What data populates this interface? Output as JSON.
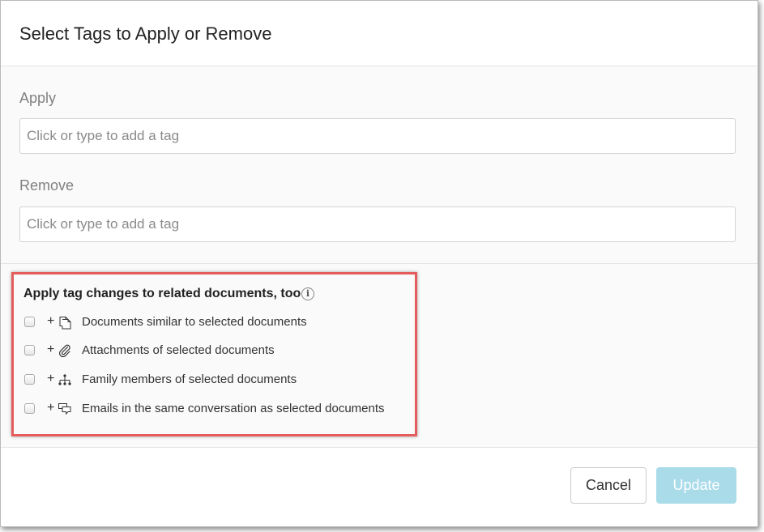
{
  "dialog": {
    "title": "Select Tags to Apply or Remove"
  },
  "apply": {
    "label": "Apply",
    "placeholder": "Click or type to add a tag",
    "value": ""
  },
  "remove": {
    "label": "Remove",
    "placeholder": "Click or type to add a tag",
    "value": ""
  },
  "related": {
    "heading": "Apply tag changes to related documents, too",
    "info_icon_glyph": "i",
    "plus_glyph": "+",
    "options": [
      {
        "label": "Documents similar to selected documents",
        "icon": "similar-documents-icon",
        "checked": false
      },
      {
        "label": "Attachments of selected documents",
        "icon": "paperclip-icon",
        "checked": false
      },
      {
        "label": "Family members of selected documents",
        "icon": "hierarchy-icon",
        "checked": false
      },
      {
        "label": "Emails in the same conversation as selected documents",
        "icon": "conversation-icon",
        "checked": false
      }
    ],
    "highlight_color": "#e45c5c"
  },
  "footer": {
    "cancel_label": "Cancel",
    "update_label": "Update",
    "update_color": "#a9dbe9"
  }
}
